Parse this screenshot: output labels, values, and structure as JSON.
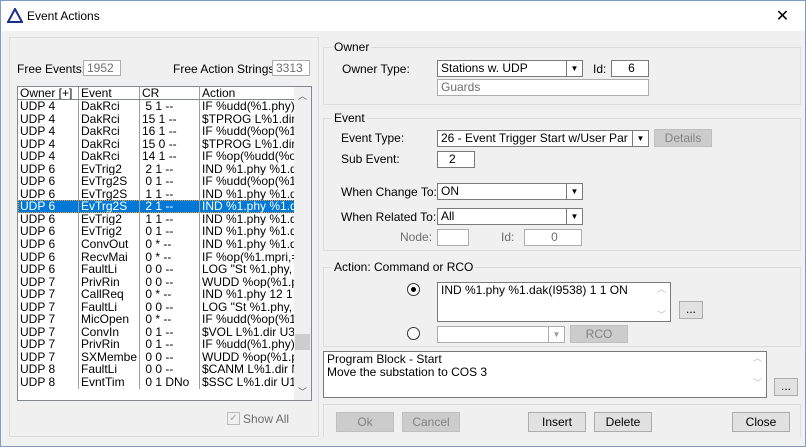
{
  "window": {
    "title": "Event Actions",
    "close": "✕"
  },
  "left": {
    "free_events_label": "Free Events:",
    "free_events": "1952",
    "free_action_strings_label": "Free Action Strings:",
    "free_action_strings": "3313",
    "columns": [
      "Owner [+]",
      "Event",
      "CR",
      "Action"
    ],
    "rows": [
      [
        "UDP 4",
        "DakRci",
        " 5 1 --",
        "IF %udd(%1.phy);$S"
      ],
      [
        "UDP 4",
        "DakRci",
        "15 1 --",
        "$TPROG L%1.dir U"
      ],
      [
        "UDP 4",
        "DakRci",
        "16 1 --",
        "IF %udd(%op(%1.pl"
      ],
      [
        "UDP 4",
        "DakRci",
        "15 0 --",
        "$TPROG L%1.dir U"
      ],
      [
        "UDP 4",
        "DakRci",
        "14 1 --",
        "IF %op(%udd(%op(%"
      ],
      [
        "UDP 6",
        "EvTrig2",
        " 2 1 --",
        "IND %1.phy %1.da"
      ],
      [
        "UDP 6",
        "EvTrg2S",
        " 0 1 --",
        "IF %udd(%op(%1.pl"
      ],
      [
        "UDP 6",
        "EvTrg2S",
        " 1 1 --",
        "IND %1.phy %1.da"
      ],
      [
        "UDP 6",
        "EvTrg2S",
        " 2 1 --",
        "IND %1.phy %1.da"
      ],
      [
        "UDP 6",
        "EvTrig2",
        " 1 1 --",
        "IND %1.phy %1.da"
      ],
      [
        "UDP 6",
        "EvTrig2",
        " 0 1 --",
        "IND %1.phy %1.da"
      ],
      [
        "UDP 6",
        "ConvOut",
        " 0 * --",
        "IND %1.phy %1.da"
      ],
      [
        "UDP 6",
        "RecvMai",
        " 0 * --",
        "IF %op(%1.mpri,=,4"
      ],
      [
        "UDP 6",
        "FaultLi",
        " 0 0 --",
        "LOG \"St %1.phy, %"
      ],
      [
        "UDP 7",
        "PrivRin",
        " 0 0 --",
        "WUDD %op(%1.ph"
      ],
      [
        "UDP 7",
        "CallReq",
        " 0 * --",
        "IND %1.phy 12 1 3"
      ],
      [
        "UDP 7",
        "FaultLi",
        " 0 0 --",
        "LOG \"St %1.phy, %"
      ],
      [
        "UDP 7",
        "MicOpen",
        " 0 * --",
        "IF %udd(%op(%1.pl"
      ],
      [
        "UDP 7",
        "ConvIn",
        " 0 1 --",
        "$VOL L%1.dir U3;II"
      ],
      [
        "UDP 7",
        "PrivRin",
        " 0 1 --",
        "IF %udd(%1.phy);$I"
      ],
      [
        "UDP 7",
        "SXMembe",
        " 0 0 --",
        "WUDD %op(%1.ph"
      ],
      [
        "UDP 8",
        "FaultLi",
        " 0 0 --",
        "$CANM L%1.dir NC"
      ],
      [
        "UDP 8",
        "EvntTim",
        " 0 1 DNo",
        "$SSC L%1.dir U1;C"
      ]
    ],
    "selected_row": 8,
    "show_all_label": "Show All",
    "show_all_checked": true
  },
  "owner": {
    "legend": "Owner",
    "type_label": "Owner Type:",
    "type_value": "Stations w. UDP",
    "id_label": "Id:",
    "id_value": "6",
    "name": "Guards"
  },
  "event": {
    "legend": "Event",
    "type_label": "Event Type:",
    "type_value": "26 - Event Trigger Start w/User Par",
    "details": "Details",
    "sub_label": "Sub Event:",
    "sub_value": "2",
    "change_label": "When Change To:",
    "change_value": "ON",
    "related_label": "When Related To:",
    "related_value": "All",
    "node_label": "Node:",
    "node_value": "",
    "id_label": "Id:",
    "id_value": "0"
  },
  "action": {
    "legend": "Action: Command or RCO",
    "command": "IND %1.phy %1.dak(I9538) 1 1 ON",
    "ellipsis": "...",
    "rco_value": "",
    "rco": "RCO",
    "command_selected": true
  },
  "comment": {
    "text": "Program Block - Start\nMove the substation to COS 3",
    "ellipsis": "..."
  },
  "buttons": {
    "ok": "Ok",
    "cancel": "Cancel",
    "insert": "Insert",
    "delete": "Delete",
    "close": "Close"
  }
}
